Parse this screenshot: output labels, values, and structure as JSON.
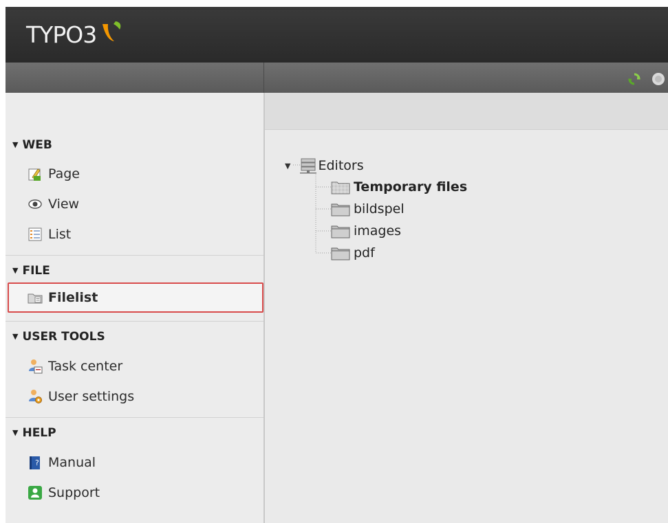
{
  "app": {
    "logo_text": "TYPO3"
  },
  "toolbar": {
    "refresh_icon": "refresh-icon",
    "help_icon": "help-icon"
  },
  "menu": {
    "groups": [
      {
        "label": "WEB",
        "items": [
          {
            "label": "Page",
            "icon": "page-icon"
          },
          {
            "label": "View",
            "icon": "eye-icon"
          },
          {
            "label": "List",
            "icon": "list-icon"
          }
        ]
      },
      {
        "label": "FILE",
        "items": [
          {
            "label": "Filelist",
            "icon": "filelist-icon",
            "active": true
          }
        ]
      },
      {
        "label": "USER TOOLS",
        "items": [
          {
            "label": "Task center",
            "icon": "task-center-icon"
          },
          {
            "label": "User settings",
            "icon": "user-settings-icon"
          }
        ]
      },
      {
        "label": "HELP",
        "items": [
          {
            "label": "Manual",
            "icon": "manual-icon"
          },
          {
            "label": "Support",
            "icon": "support-icon"
          }
        ]
      }
    ]
  },
  "tree": {
    "root": {
      "label": "Editors",
      "icon": "file-mount-icon",
      "expanded": true
    },
    "children": [
      {
        "label": "Temporary files",
        "icon": "temp-folder-icon",
        "selected": true
      },
      {
        "label": "bildspel",
        "icon": "folder-icon"
      },
      {
        "label": "images",
        "icon": "folder-icon"
      },
      {
        "label": "pdf",
        "icon": "folder-icon"
      }
    ]
  },
  "colors": {
    "header_bg": "#2f2f2f",
    "menu_bg": "#ececec",
    "content_bg": "#eaeaea",
    "active_border": "#d84a4a",
    "logo_orange": "#f49700",
    "logo_green": "#7fbf2a"
  }
}
